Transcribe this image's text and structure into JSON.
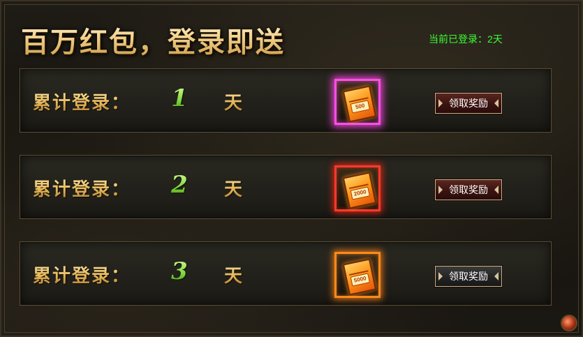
{
  "header": {
    "title": "百万红包，登录即送",
    "status_label": "当前已登录：",
    "status_value": "2天"
  },
  "rows": [
    {
      "label": "累计登录：",
      "day": "1",
      "unit": "天",
      "reward_icon": "red-envelope-icon",
      "reward_tag": "500",
      "button": "领取奖励",
      "highlight": "#ff4fe8"
    },
    {
      "label": "累计登录：",
      "day": "2",
      "unit": "天",
      "reward_icon": "red-envelope-icon",
      "reward_tag": "2000",
      "button": "领取奖励",
      "highlight": "#ff3a2a"
    },
    {
      "label": "累计登录：",
      "day": "3",
      "unit": "天",
      "reward_icon": "red-envelope-icon",
      "reward_tag": "5000",
      "button": "领取奖励",
      "highlight": "#ff8a1a"
    }
  ]
}
